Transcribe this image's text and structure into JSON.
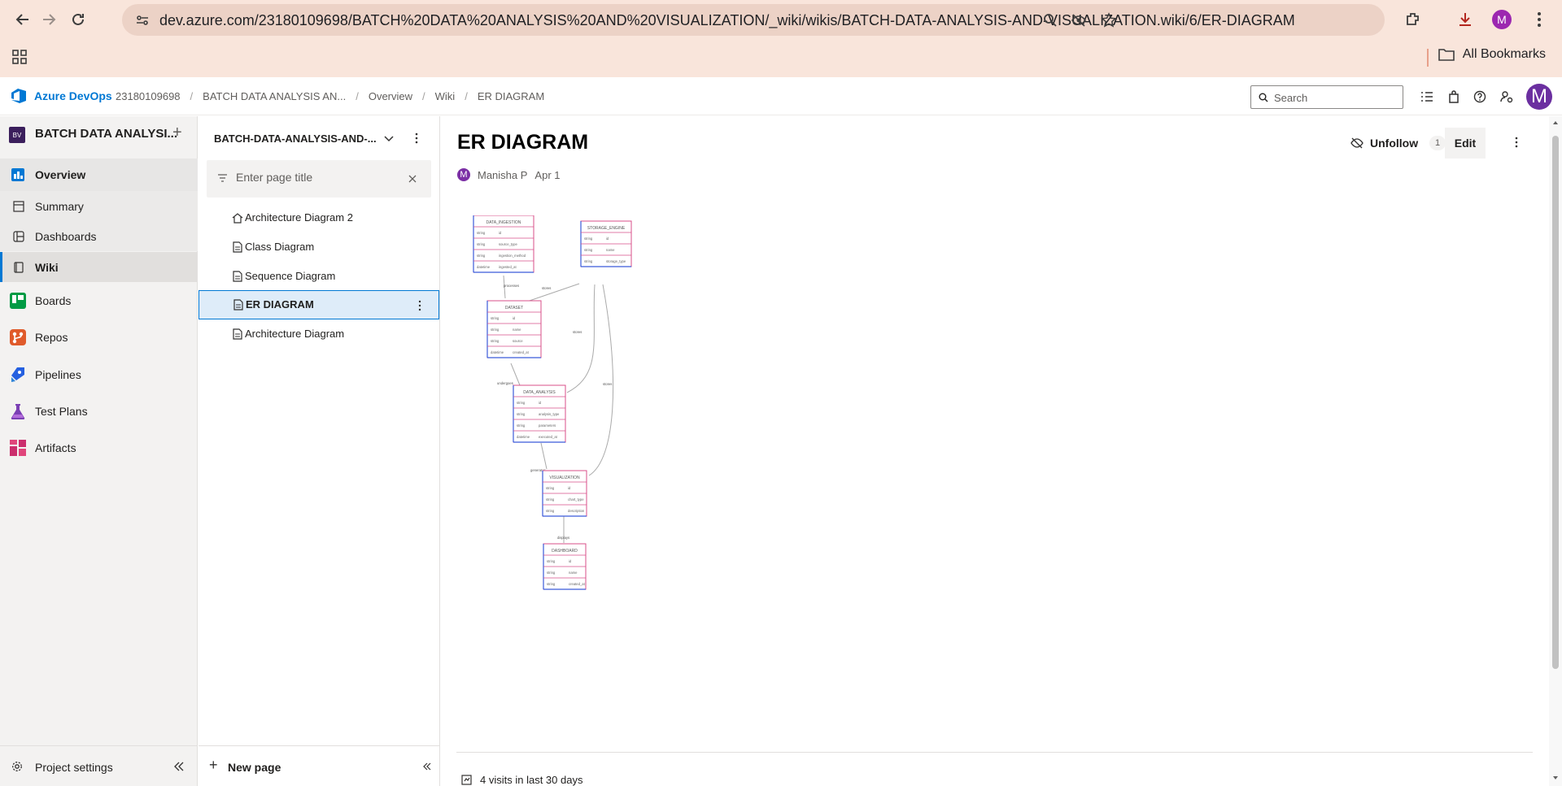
{
  "browser": {
    "url": "dev.azure.com/23180109698/BATCH%20DATA%20ANALYSIS%20AND%20VISUALIZATION/_wiki/wikis/BATCH-DATA-ANALYSIS-AND-VISUALIZATION.wiki/6/ER-DIAGRAM",
    "profile_initial": "M",
    "bookmarks_label": "All Bookmarks"
  },
  "header": {
    "brand": "Azure DevOps",
    "breadcrumbs": [
      "23180109698",
      "BATCH DATA ANALYSIS AN...",
      "Overview",
      "Wiki",
      "ER DIAGRAM"
    ],
    "search_placeholder": "Search",
    "user_initial": "M"
  },
  "project": {
    "badge": "BV",
    "name": "BATCH DATA ANALYSI..."
  },
  "nav": {
    "items": [
      {
        "label": "Overview"
      },
      {
        "label": "Summary"
      },
      {
        "label": "Dashboards"
      },
      {
        "label": "Wiki"
      },
      {
        "label": "Boards"
      },
      {
        "label": "Repos"
      },
      {
        "label": "Pipelines"
      },
      {
        "label": "Test Plans"
      },
      {
        "label": "Artifacts"
      }
    ],
    "settings_label": "Project settings"
  },
  "wiki_tree": {
    "wiki_name": "BATCH-DATA-ANALYSIS-AND-...",
    "filter_placeholder": "Enter page title",
    "pages": [
      {
        "label": "Architecture Diagram 2"
      },
      {
        "label": "Class Diagram"
      },
      {
        "label": "Sequence Diagram"
      },
      {
        "label": "ER DIAGRAM"
      },
      {
        "label": "Architecture Diagram"
      }
    ],
    "new_page_label": "New page"
  },
  "page": {
    "title": "ER DIAGRAM",
    "author": "Manisha P",
    "author_initial": "M",
    "date": "Apr 1",
    "unfollow_label": "Unfollow",
    "follow_count": "1",
    "edit_label": "Edit",
    "visits": "4 visits in last 30 days"
  },
  "er_diagram": {
    "entities": [
      {
        "name": "DATA_INGESTION",
        "fields": [
          [
            "string",
            "id"
          ],
          [
            "string",
            "source_type"
          ],
          [
            "string",
            "ingestion_method"
          ],
          [
            "datetime",
            "ingested_at"
          ]
        ]
      },
      {
        "name": "STORAGE_ENGINE",
        "fields": [
          [
            "string",
            "id"
          ],
          [
            "string",
            "name"
          ],
          [
            "string",
            "storage_type"
          ]
        ]
      },
      {
        "name": "DATASET",
        "fields": [
          [
            "string",
            "id"
          ],
          [
            "string",
            "name"
          ],
          [
            "string",
            "source"
          ],
          [
            "datetime",
            "created_at"
          ]
        ]
      },
      {
        "name": "DATA_ANALYSIS",
        "fields": [
          [
            "string",
            "id"
          ],
          [
            "string",
            "analysis_type"
          ],
          [
            "string",
            "parameters"
          ],
          [
            "datetime",
            "executed_at"
          ]
        ]
      },
      {
        "name": "VISUALIZATION",
        "fields": [
          [
            "string",
            "id"
          ],
          [
            "string",
            "chart_type"
          ],
          [
            "string",
            "description"
          ]
        ]
      },
      {
        "name": "DASHBOARD",
        "fields": [
          [
            "string",
            "id"
          ],
          [
            "string",
            "name"
          ],
          [
            "string",
            "created_at"
          ]
        ]
      }
    ],
    "relationships": [
      "processes",
      "stores",
      "stores",
      "stores",
      "undergoes",
      "generates",
      "displays"
    ]
  }
}
